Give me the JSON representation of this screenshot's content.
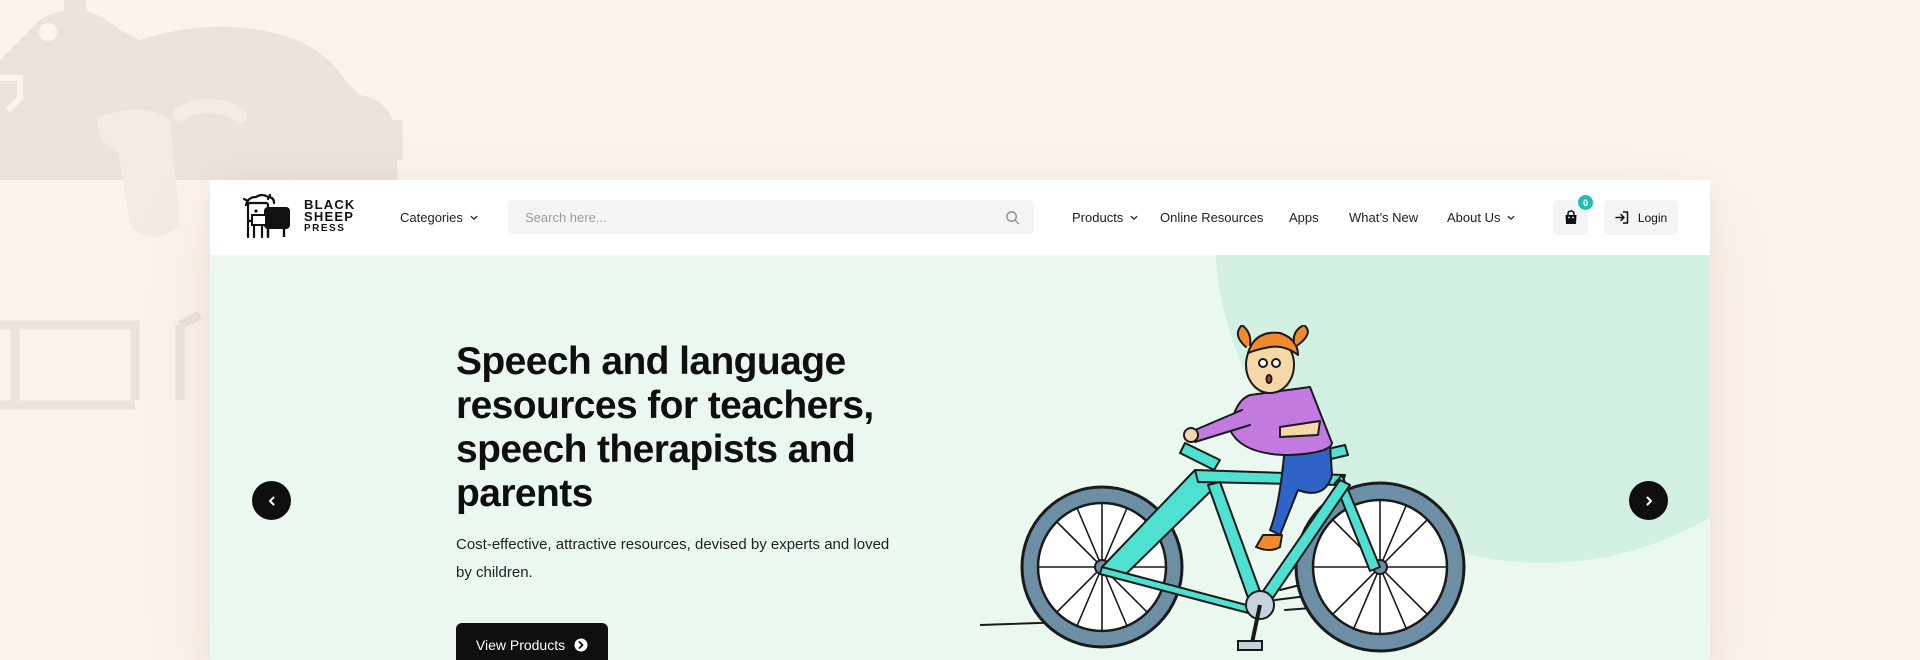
{
  "brand": {
    "name_line1": "BLACK",
    "name_line2": "SHEEP",
    "name_line3": "PRESS"
  },
  "nav": {
    "categories": "Categories",
    "products": "Products",
    "online_resources": "Online Resources",
    "apps": "Apps",
    "whats_new": "What’s New",
    "about_us": "About Us",
    "login": "Login"
  },
  "search": {
    "placeholder": "Search here...",
    "value": ""
  },
  "cart": {
    "count": "0"
  },
  "hero": {
    "title": "Speech and language resources for teachers, speech therapists and parents",
    "subtitle": "Cost-effective, attractive resources, devised by experts and loved by children.",
    "cta_label": "View Products"
  },
  "icons": {
    "search": "search-icon",
    "cart": "shopping-bag-icon",
    "login": "login-arrow-icon",
    "prev": "chevron-left-icon",
    "next": "chevron-right-icon",
    "cta": "arrow-circle-right-icon",
    "dropdown": "chevron-down-icon"
  },
  "colors": {
    "page_background": "#fcf3ed",
    "hero_background": "#eaf8f0",
    "hero_circle": "#d3f1e3",
    "accent_teal": "#1fbfb0",
    "button_dark": "#0f0f0f"
  }
}
